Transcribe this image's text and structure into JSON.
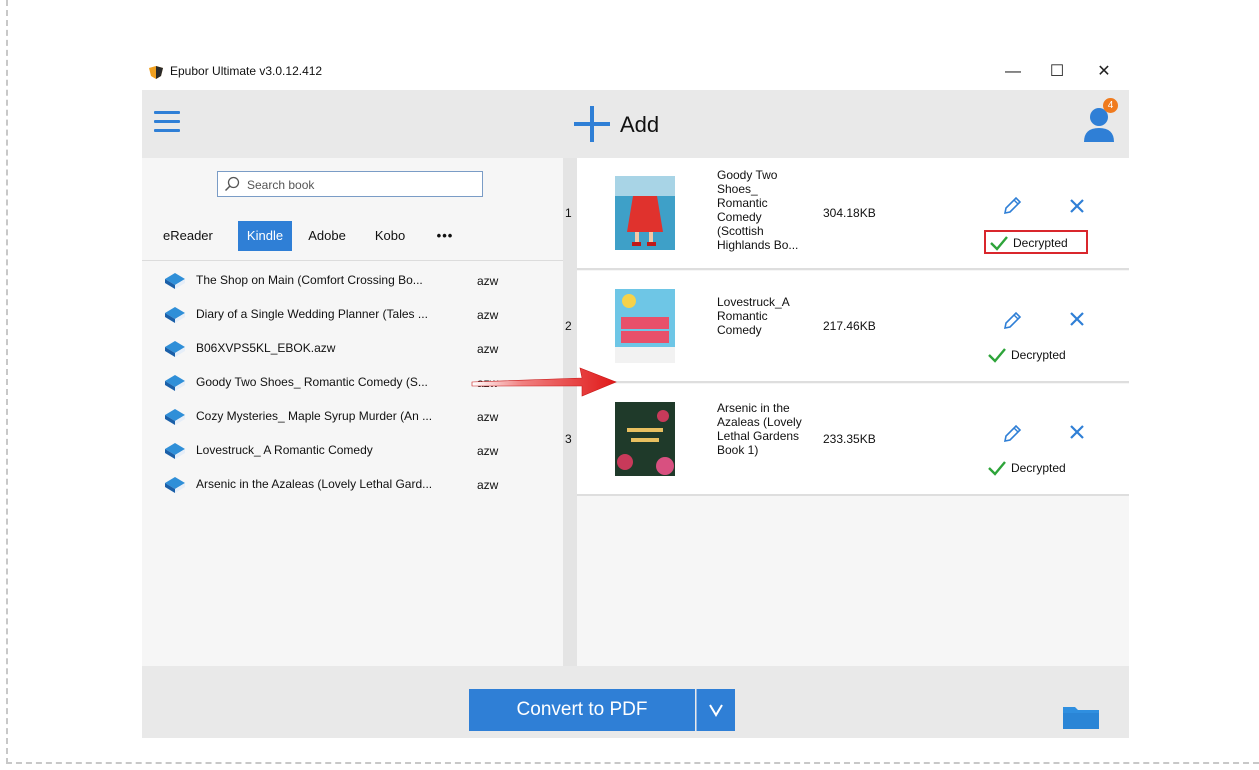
{
  "window": {
    "title": "Epubor Ultimate v3.0.12.412",
    "controls": [
      "—",
      "☐",
      "✕"
    ]
  },
  "toolbar": {
    "add_label": "Add",
    "notification_count": "4"
  },
  "search": {
    "placeholder": "Search book"
  },
  "tabs": [
    {
      "label": "eReader",
      "active": false
    },
    {
      "label": "Kindle",
      "active": true
    },
    {
      "label": "Adobe",
      "active": false
    },
    {
      "label": "Kobo",
      "active": false
    },
    {
      "label": "•••",
      "active": false
    }
  ],
  "library": [
    {
      "title": "The Shop on Main (Comfort Crossing Bo...",
      "type": "azw"
    },
    {
      "title": "Diary of a Single Wedding Planner (Tales ...",
      "type": "azw"
    },
    {
      "title": "B06XVPS5KL_EBOK.azw",
      "type": "azw"
    },
    {
      "title": "Goody Two Shoes_ Romantic Comedy (S...",
      "type": "azw"
    },
    {
      "title": "Cozy Mysteries_ Maple Syrup Murder (An ...",
      "type": "azw"
    },
    {
      "title": "Lovestruck_ A Romantic Comedy",
      "type": "azw"
    },
    {
      "title": "Arsenic in the Azaleas (Lovely Lethal Gard...",
      "type": "azw"
    }
  ],
  "conversions": [
    {
      "num": "1",
      "title_lines": [
        "Goody Two",
        "Shoes_",
        "Romantic",
        "Comedy",
        "(Scottish",
        "Highlands Bo..."
      ],
      "size": "304.18KB",
      "status": "Decrypted",
      "highlighted": true,
      "cover_colors": [
        "#3ea0c8",
        "#e0322d"
      ]
    },
    {
      "num": "2",
      "title_lines": [
        "Lovestruck_A",
        "Romantic",
        "Comedy"
      ],
      "size": "217.46KB",
      "status": "Decrypted",
      "highlighted": false,
      "cover_colors": [
        "#6ec6e6",
        "#e8506a"
      ]
    },
    {
      "num": "3",
      "title_lines": [
        "Arsenic in the",
        "Azaleas (Lovely",
        "Lethal Gardens",
        "Book 1)"
      ],
      "size": "233.35KB",
      "status": "Decrypted",
      "highlighted": false,
      "cover_colors": [
        "#1f3a2a",
        "#c83a5a"
      ]
    }
  ],
  "bottom": {
    "convert_label": "Convert to PDF",
    "dropdown_symbol": "∨"
  },
  "colors": {
    "accent": "#2f7fd6",
    "success": "#2ea43a",
    "highlight": "#d9262c",
    "badge": "#f07b1e"
  },
  "icons": {
    "app": "epubor-logo-icon",
    "menu": "hamburger-menu-icon",
    "add": "plus-icon",
    "user": "user-icon",
    "search": "search-icon",
    "book": "book-icon",
    "edit": "pencil-icon",
    "delete": "close-icon",
    "status": "checkmark-icon",
    "folder": "folder-icon"
  }
}
